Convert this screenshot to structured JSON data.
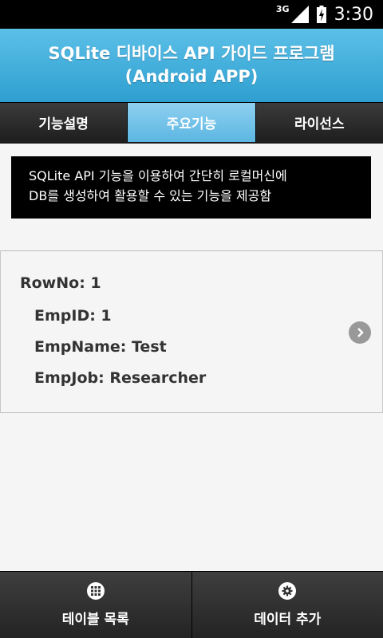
{
  "status": {
    "network": "3G",
    "time": "3:30"
  },
  "header": {
    "line1": "SQLite 디바이스 API 가이드 프로그램",
    "line2": "(Android APP)"
  },
  "tabs": [
    {
      "label": "기능설명"
    },
    {
      "label": "주요기능"
    },
    {
      "label": "라이선스"
    }
  ],
  "description": {
    "line1": "SQLite API 기능을 이용하여 간단히 로컬머신에",
    "line2": "DB를 생성하여 활용할 수 있는 기능을 제공함"
  },
  "record": {
    "row_no": "RowNo: 1",
    "emp_id": "EmpID: 1",
    "emp_name": "EmpName: Test",
    "emp_job": "EmpJob: Researcher"
  },
  "bottom": {
    "left_label": "테이블 목록",
    "right_label": "데이터 추가"
  },
  "colors": {
    "header": "#2e9fd0",
    "active_tab": "#5bb6e2",
    "bar": "#242424"
  },
  "icons": {
    "list": "grid-icon",
    "add": "gear-icon",
    "detail": "chevron-right-icon"
  }
}
